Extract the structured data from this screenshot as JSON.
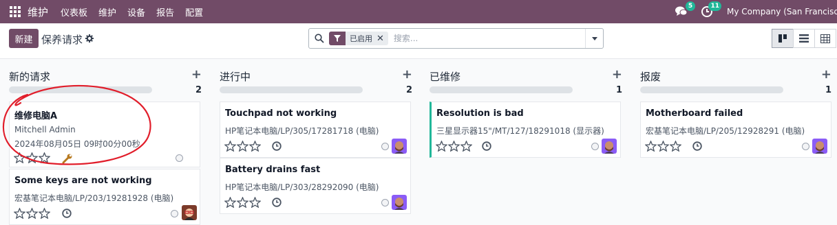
{
  "navbar": {
    "brand": "维护",
    "menus": [
      "仪表板",
      "维护",
      "设备",
      "报告",
      "配置"
    ],
    "messages_badge": "5",
    "activity_badge": "11",
    "company": "My Company (San Francisco)"
  },
  "control": {
    "new_label": "新建",
    "title": "保养请求",
    "facet_label": "已启用",
    "search_placeholder": "搜索..."
  },
  "columns": [
    {
      "title": "新的请求",
      "count": "2",
      "cards": [
        {
          "title": "维修电脑A",
          "line1": "Mitchell Admin",
          "line2": "2024年08月05日 09时00分00秒",
          "icon": "wrench-icon",
          "avatar": "none"
        },
        {
          "title": "Some keys are not working",
          "line1": "宏基笔记本电脑/LP/203/19281928 (电脑)",
          "line2": "",
          "icon": "clock-icon",
          "avatar": "avatar-red-glasses"
        }
      ]
    },
    {
      "title": "进行中",
      "count": "2",
      "cards": [
        {
          "title": "Touchpad not working",
          "line1": "HP笔记本电脑/LP/305/17281718 (电脑)",
          "line2": "",
          "icon": "clock-icon",
          "avatar": "avatar-bearded"
        },
        {
          "title": "Battery drains fast",
          "line1": "HP笔记本电脑/LP/303/28292090 (电脑)",
          "line2": "",
          "icon": "clock-icon",
          "avatar": "avatar-bearded"
        }
      ]
    },
    {
      "title": "已维修",
      "count": "1",
      "cards": [
        {
          "title": "Resolution is bad",
          "line1": "三星显示器15\"/MT/127/18291018 (显示器)",
          "line2": "",
          "icon": "clock-icon",
          "avatar": "avatar-bearded"
        }
      ]
    },
    {
      "title": "报废",
      "count": "1",
      "cards": [
        {
          "title": "Motherboard failed",
          "line1": "宏基笔记本电脑/LP/205/12928291 (电脑)",
          "line2": "",
          "icon": "clock-icon",
          "avatar": "avatar-bearded"
        }
      ]
    }
  ],
  "colors": {
    "brand": "#714b67",
    "badge": "#21b799",
    "repaired_border": "#21b799",
    "annotation_circle": "#e11d2a"
  }
}
